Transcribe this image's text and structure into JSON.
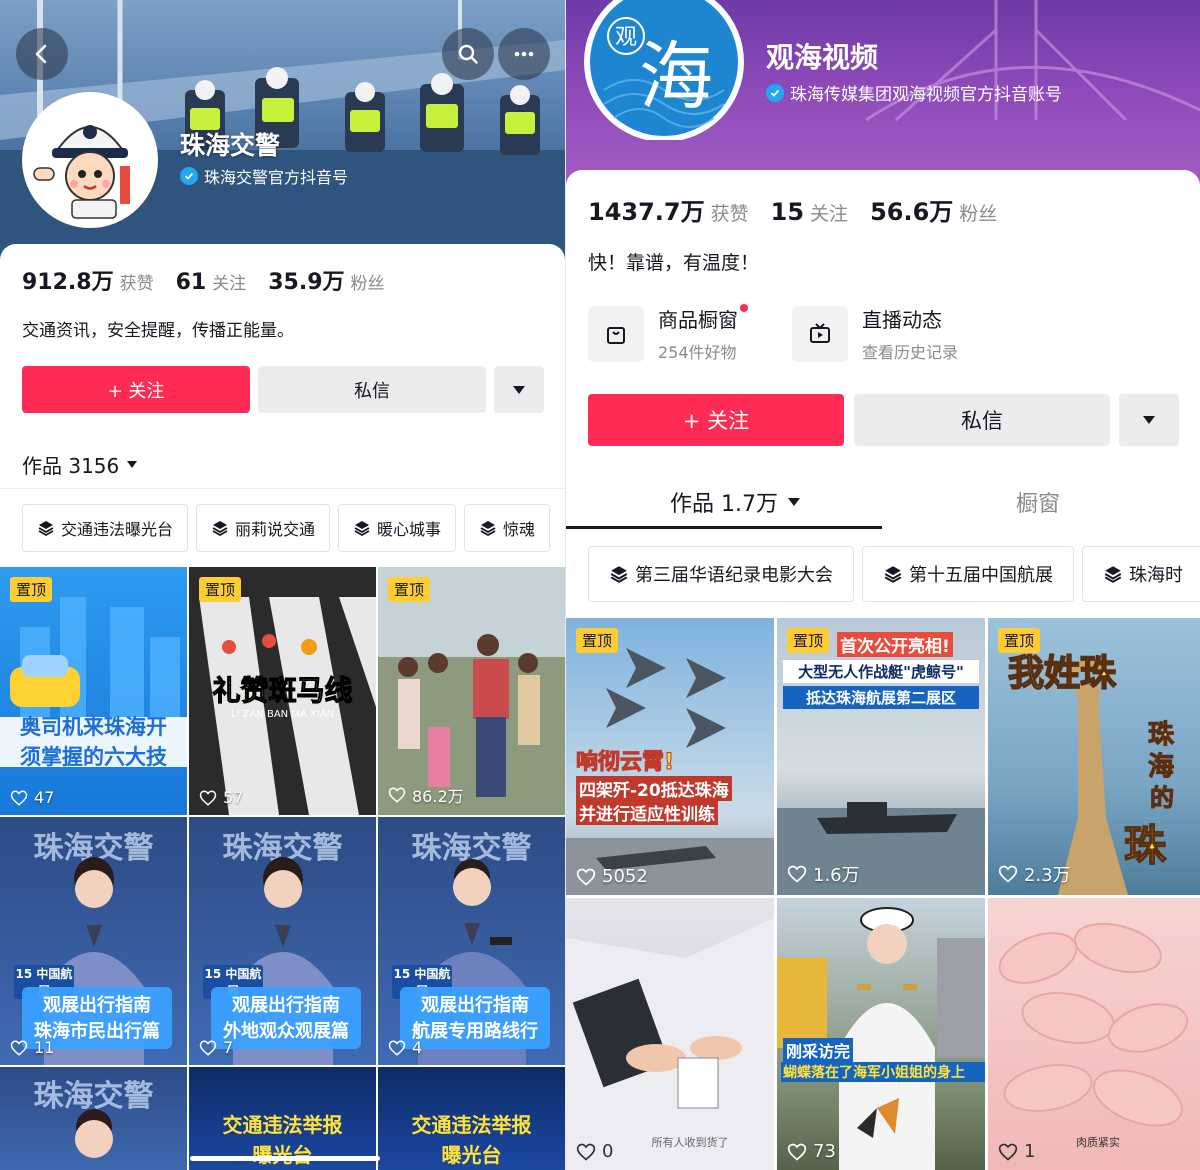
{
  "left": {
    "account_name": "珠海交警",
    "verification": "珠海交警官方抖音号",
    "stats": [
      {
        "num": "912.8万",
        "label": "获赞"
      },
      {
        "num": "61",
        "label": "关注"
      },
      {
        "num": "35.9万",
        "label": "粉丝"
      }
    ],
    "bio": "交通资讯，安全提醒，传播正能量。",
    "follow_label": "+ 关注",
    "message_label": "私信",
    "works_label": "作品 3156",
    "collections": [
      "交通违法曝光台",
      "丽莉说交通",
      "暖心城事",
      "惊魂"
    ],
    "videos": [
      {
        "pinned": "置顶",
        "likes": "47",
        "lines": [
          "奥司机来珠海开",
          "须掌握的六大技"
        ]
      },
      {
        "pinned": "置顶",
        "likes": "57",
        "lines": [
          "礼赞斑马线",
          "LI ZAN BAN MA XIAN"
        ]
      },
      {
        "pinned": "置顶",
        "likes": "86.2万",
        "lines": []
      },
      {
        "pinned": "",
        "likes": "11",
        "lines": [
          "珠海交警",
          "观展出行指南",
          "珠海市民出行篇"
        ]
      },
      {
        "pinned": "",
        "likes": "7",
        "lines": [
          "珠海交警",
          "观展出行指南",
          "外地观众观展篇"
        ]
      },
      {
        "pinned": "",
        "likes": "4",
        "lines": [
          "珠海交警",
          "观展出行指南",
          "航展专用路线行"
        ]
      },
      {
        "pinned": "",
        "likes": "",
        "lines": [
          "珠海交警"
        ]
      },
      {
        "pinned": "",
        "likes": "",
        "lines": [
          "交通违法举报",
          "曝光台"
        ]
      },
      {
        "pinned": "",
        "likes": "",
        "lines": [
          "交通违法举报",
          "曝光台"
        ]
      }
    ],
    "airshow_badge": "15 中国航展",
    "airshow_sub": "AIRSHOW CHINA"
  },
  "right": {
    "account_name": "观海视频",
    "verification": "珠海传媒集团观海视频官方抖音账号",
    "avatar_text": [
      "观",
      "海"
    ],
    "stats": [
      {
        "num": "1437.7万",
        "label": "获赞"
      },
      {
        "num": "15",
        "label": "关注"
      },
      {
        "num": "56.6万",
        "label": "粉丝"
      }
    ],
    "bio": "快！靠谱，有温度！",
    "shop_title": "商品橱窗",
    "shop_sub": "254件好物",
    "live_title": "直播动态",
    "live_sub": "查看历史记录",
    "follow_label": "+ 关注",
    "message_label": "私信",
    "tab_works": "作品 1.7万",
    "tab_shop": "橱窗",
    "collections": [
      "第三届华语纪录电影大会",
      "第十五届中国航展",
      "珠海时"
    ],
    "videos": [
      {
        "pinned": "置顶",
        "likes": "5052",
        "lines": [
          "响彻云霄!",
          "四架歼-20抵达珠海",
          "并进行适应性训练"
        ]
      },
      {
        "pinned": "置顶",
        "likes": "1.6万",
        "lines": [
          "首次公开亮相!",
          "大型无人作战艇\"虎鲸号\"",
          "抵达珠海航展第二展区"
        ]
      },
      {
        "pinned": "置顶",
        "likes": "2.3万",
        "lines": [
          "我姓珠",
          "珠",
          "海",
          "的",
          "珠"
        ]
      },
      {
        "pinned": "",
        "likes": "0",
        "lines": [
          "所有人收到货了"
        ]
      },
      {
        "pinned": "",
        "likes": "73",
        "lines": [
          "刚采访完",
          "蝴蝶落在了海军小姐姐的身上"
        ]
      },
      {
        "pinned": "",
        "likes": "1",
        "lines": [
          "肉质紧实"
        ]
      }
    ]
  },
  "icons": {
    "back": "chevron-left-icon",
    "search": "search-icon",
    "more": "more-icon",
    "verified": "verified-icon",
    "heart": "heart-icon",
    "collection": "stack-icon",
    "dropdown": "triangle-down-icon"
  },
  "colors": {
    "accent": "#fe2c55",
    "pin": "#ffcd32",
    "verified": "#22a7f2"
  }
}
